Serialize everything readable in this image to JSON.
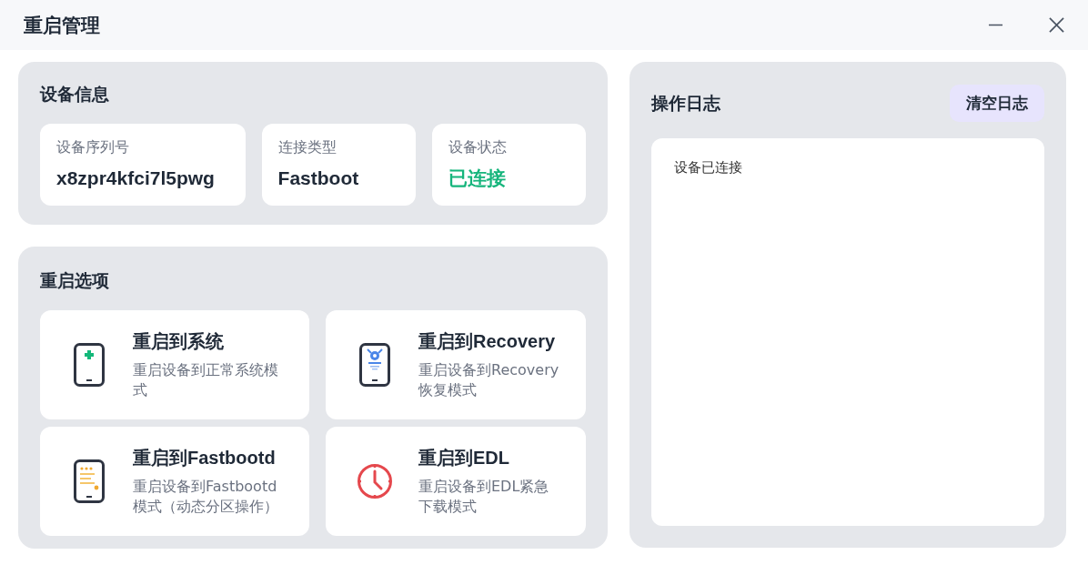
{
  "window": {
    "title": "重启管理"
  },
  "device_info": {
    "title": "设备信息",
    "fields": [
      {
        "label": "设备序列号",
        "value": "x8zpr4kfci7l5pwg",
        "kind": "text"
      },
      {
        "label": "连接类型",
        "value": "Fastboot",
        "kind": "text"
      },
      {
        "label": "设备状态",
        "value": "已连接",
        "kind": "status"
      }
    ]
  },
  "restart_options": {
    "title": "重启选项",
    "options": [
      {
        "title": "重启到系统",
        "description": "重启设备到正常系统模式",
        "kind": "system"
      },
      {
        "title": "重启到Recovery",
        "description": "重启设备到Recovery恢复模式",
        "kind": "recovery"
      },
      {
        "title": "重启到Fastbootd",
        "description": "重启设备到Fastbootd模式（动态分区操作）",
        "kind": "fastbootd"
      },
      {
        "title": "重启到EDL",
        "description": "重启设备到EDL紧急下载模式",
        "kind": "edl"
      }
    ]
  },
  "log": {
    "title": "操作日志",
    "clear_button": "清空日志",
    "entries": [
      "设备已连接"
    ]
  }
}
